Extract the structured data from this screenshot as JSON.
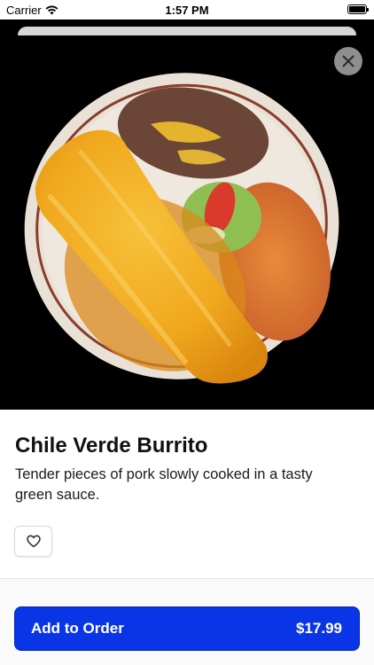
{
  "status_bar": {
    "carrier": "Carrier",
    "time": "1:57 PM"
  },
  "item": {
    "name": "Chile Verde Burrito",
    "description": "Tender pieces of pork slowly cooked in a tasty green sauce.",
    "image_icon": "burrito-plate-image"
  },
  "actions": {
    "close_icon": "close-icon",
    "favorite_icon": "heart-icon",
    "add_label": "Add to Order",
    "price": "$17.99"
  },
  "colors": {
    "accent": "#0a35e6",
    "background": "#ffffff",
    "hero_bg": "#000000"
  }
}
